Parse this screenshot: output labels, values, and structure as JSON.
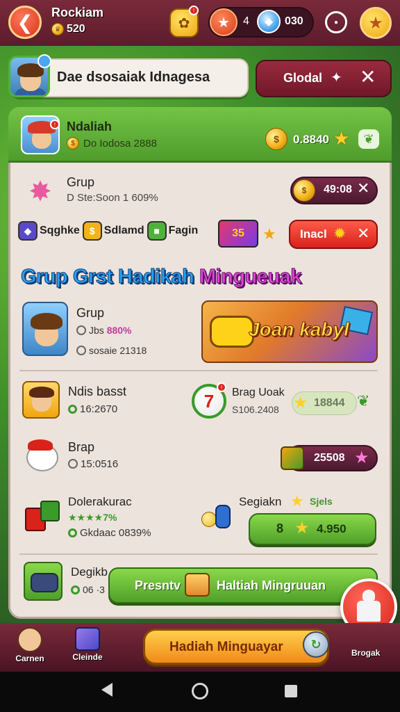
{
  "topbar": {
    "back_glyph": "❮",
    "player_name": "Rockiam",
    "coins": "520",
    "resource_a": "4",
    "resource_b": "030",
    "star_glyph": "★",
    "gem_glyph": "◆",
    "gift_badge": "!",
    "fav_glyph": "★"
  },
  "notice": {
    "text": "Dae dsosaiak Idnagesa",
    "global_label": "Glodal",
    "global_star": "✦",
    "close_glyph": "✕"
  },
  "header": {
    "title": "Ndaliah",
    "subtitle": "Do Iodosa 2888",
    "score": "0.8840",
    "badge": "!"
  },
  "group": {
    "title": "Grup",
    "subtitle": "D Ste:Soon 1 609%",
    "pill_value": "49:08",
    "close_glyph": "✕"
  },
  "categories": [
    {
      "label": "Sqghke",
      "color": "#5a4ac8",
      "glyph": "◆"
    },
    {
      "label": "Sdlamd",
      "color": "#f2b31a",
      "glyph": "$"
    },
    {
      "label": "Fagin",
      "color": "#4fb23a",
      "glyph": "■"
    }
  ],
  "category_extra": "35",
  "inactive_label": "Inacl",
  "banner": {
    "title_a": "Grup Grst Hadikah ",
    "title_b": "Mingueuak"
  },
  "group2": {
    "title": "Grup",
    "stat_prefix": "Jbs ",
    "stat_accent": "880%",
    "stat2": "sosaie 21318",
    "promo_text": "Joan kabyl"
  },
  "players": [
    {
      "name": "Ndis basst",
      "stat": "16:2670"
    },
    {
      "name": "Brap",
      "stat": "15:0516"
    },
    {
      "name": "Dolerakurac",
      "stat": "★★★★7%",
      "sub": "Gkdaac 0839%"
    },
    {
      "name": "Degikb",
      "stat": "06 ·3"
    }
  ],
  "player1b": {
    "name": "Brag Uoak",
    "stat": "S106.2408",
    "pill_value": "18844",
    "icon_glyph": "7"
  },
  "player2_value": "25508",
  "player3b": {
    "name": "Segiakn",
    "tag": "Sjels",
    "claim_num": "8",
    "claim_value": "4.950"
  },
  "present": {
    "label": "Presntv",
    "text": "Haltiah Mingruuan"
  },
  "nav": {
    "cartoon_label": "Carnen",
    "cubes_label": "Cleinde",
    "weekly_label": "Hadiah Minguayar",
    "right_label": "Brogak"
  },
  "colors": {
    "topbar": "#6a2232",
    "panel": "#ece3dc",
    "header_green": "#5faf36",
    "accent_blue": "#2aa0f0",
    "accent_magenta": "#e046d8",
    "cta_orange": "#f5a623"
  }
}
